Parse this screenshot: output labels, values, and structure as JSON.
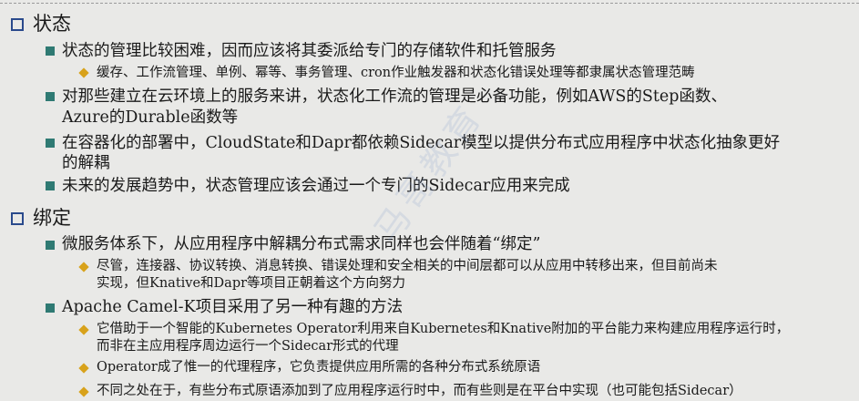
{
  "sections": [
    {
      "heading": "状态",
      "items": [
        {
          "text": "状态的管理比较困难，因而应该将其委派给专门的存储软件和托管服务",
          "subitems": [
            "缓存、工作流管理、单例、幂等、事务管理、cron作业触发器和状态化错误处理等都隶属状态管理范畴"
          ]
        },
        {
          "text_lines": [
            "对那些建立在云环境上的服务来讲，状态化工作流的管理是必备功能，例如AWS的Step函数、",
            "Azure的Durable函数等"
          ]
        },
        {
          "text_lines": [
            "在容器化的部署中，CloudState和Dapr都依赖Sidecar模型以提供分布式应用程序中状态化抽象更好",
            "的解耦"
          ]
        },
        {
          "text": "未来的发展趋势中，状态管理应该会通过一个专门的Sidecar应用来完成"
        }
      ]
    },
    {
      "heading": "绑定",
      "items": [
        {
          "text": "微服务体系下，从应用程序中解耦分布式需求同样也会伴随着“绑定”",
          "subitems_lines": [
            [
              "尽管，连接器、协议转换、消息转换、错误处理和安全相关的中间层都可以从应用中转移出来，但目前尚未",
              "实现，但Knative和Dapr等项目正朝着这个方向努力"
            ]
          ]
        },
        {
          "text": "Apache Camel-K项目采用了另一种有趣的方法",
          "subitems_lines": [
            [
              "它借助于一个智能的Kubernetes Operator利用来自Kubernetes和Knative附加的平台能力来构建应用程序运行时，",
              "而非在主应用程序周边运行一个Sidecar形式的代理"
            ],
            [
              "Operator成了惟一的代理程序，它负责提供应用所需的各种分布式系统原语"
            ],
            [
              "不同之处在于，有些分布式原语添加到了应用程序运行时中，而有些则是在平台中实现（也可能包括Sidecar）"
            ]
          ]
        }
      ]
    }
  ],
  "watermark": "马哥教育",
  "colors": {
    "background": "#e9e9e7",
    "level1_bullet": "#2a4a8c",
    "level2_bullet": "#2f7a73",
    "level3_bullet": "#d8a21b"
  }
}
